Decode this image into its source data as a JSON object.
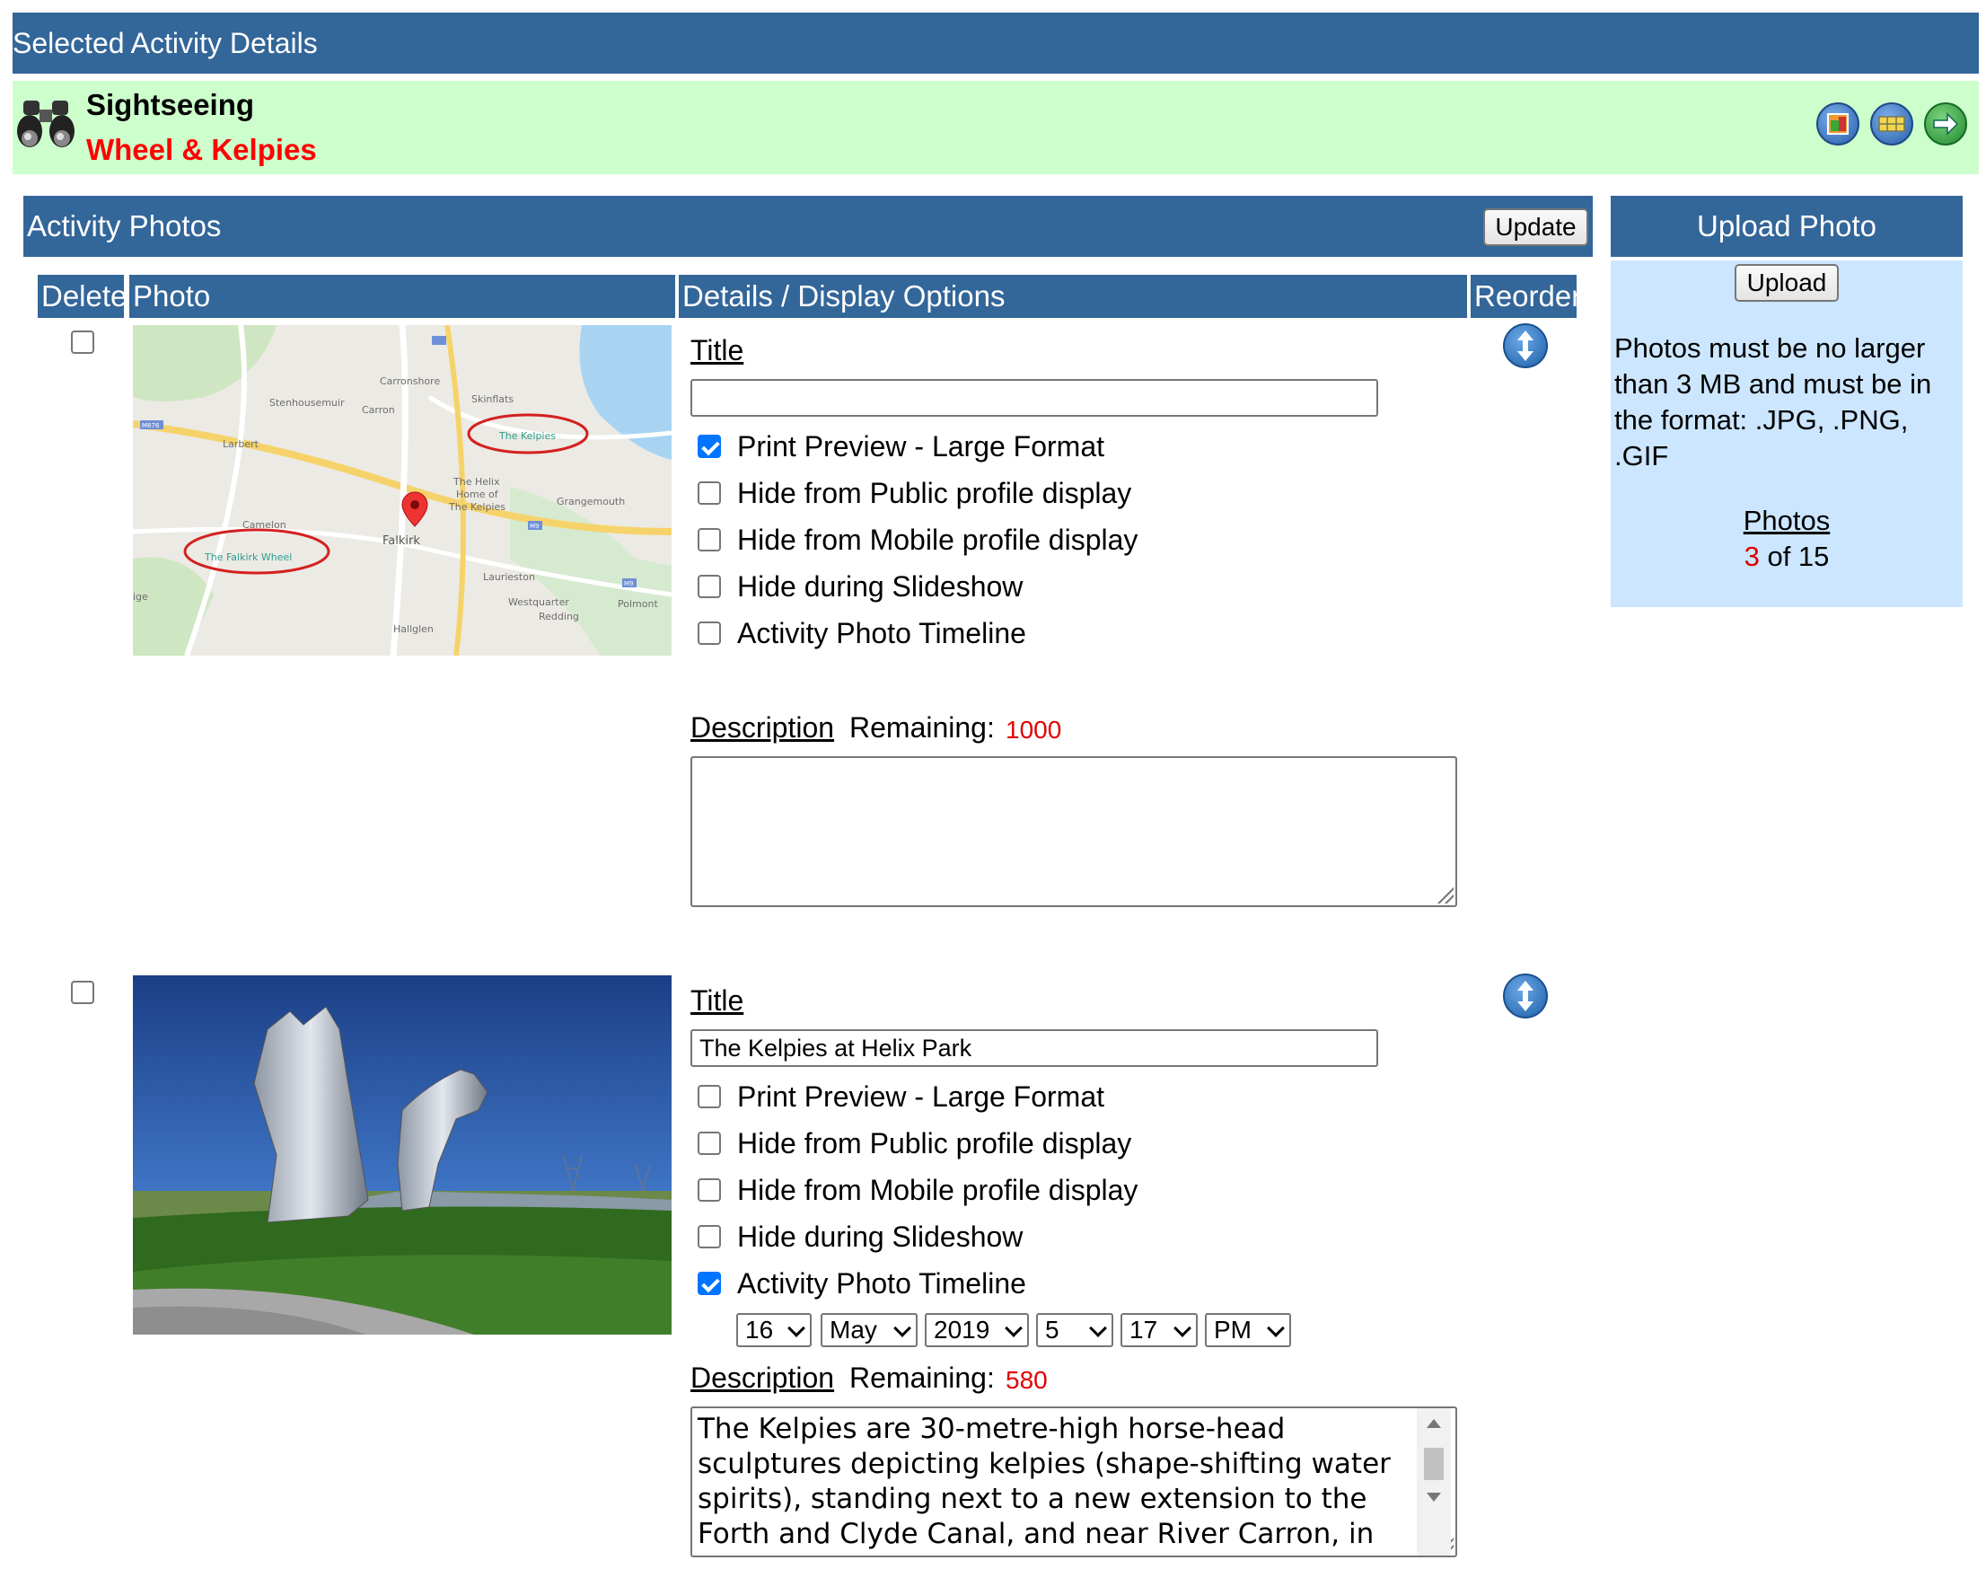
{
  "header": {
    "title": "Selected Activity Details"
  },
  "activity": {
    "type": "Sightseeing",
    "name": "Wheel & Kelpies",
    "icons": [
      "binoculars-icon",
      "gallery-icon",
      "calendar-icon",
      "next-arrow-icon"
    ]
  },
  "photos_panel": {
    "title": "Activity Photos",
    "update_label": "Update",
    "columns": {
      "delete": "Delete",
      "photo": "Photo",
      "details": "Details / Display Options",
      "reorder": "Reorder"
    }
  },
  "upload_panel": {
    "title": "Upload Photo",
    "upload_label": "Upload",
    "note": "Photos must be no larger than 3 MB and must be in the format: .JPG, .PNG, .GIF",
    "photos_link": "Photos",
    "count_current": "3",
    "count_suffix": " of 15"
  },
  "rows": [
    {
      "title_label": "Title",
      "title_value": "",
      "options": [
        {
          "label": "Print Preview - Large Format",
          "checked": true
        },
        {
          "label": "Hide from Public profile display",
          "checked": false
        },
        {
          "label": "Hide from Mobile profile display",
          "checked": false
        },
        {
          "label": "Hide during Slideshow",
          "checked": false
        },
        {
          "label": "Activity Photo Timeline",
          "checked": false
        }
      ],
      "description_label": "Description",
      "remaining_label": "Remaining:",
      "remaining_value": "1000",
      "description": "",
      "map_labels": {
        "carronshore": "Carronshore",
        "stenhousemuir": "Stenhousemuir",
        "carron": "Carron",
        "skinflats": "Skinflats",
        "kelpies": "The Kelpies",
        "larbert": "Larbert",
        "helix_1": "The Helix",
        "helix_2": "Home of",
        "helix_3": "The Kelpies",
        "grangemouth": "Grangemouth",
        "camelon": "Camelon",
        "falkirk_wheel": "The Falkirk Wheel",
        "falkirk": "Falkirk",
        "laurieston": "Laurieston",
        "westquarter": "Westquarter",
        "redding": "Redding",
        "polmont": "Polmont",
        "hallglen": "Hallglen",
        "ige": "ige",
        "m876": "M876",
        "m9": "M9",
        "m9b": "M9"
      }
    },
    {
      "title_label": "Title",
      "title_value": "The Kelpies at Helix Park",
      "options": [
        {
          "label": "Print Preview - Large Format",
          "checked": false
        },
        {
          "label": "Hide from Public profile display",
          "checked": false
        },
        {
          "label": "Hide from Mobile profile display",
          "checked": false
        },
        {
          "label": "Hide during Slideshow",
          "checked": false
        },
        {
          "label": "Activity Photo Timeline",
          "checked": true
        }
      ],
      "timeline": {
        "day": "16",
        "month": "May",
        "year": "2019",
        "hour": "5",
        "minute": "17",
        "ampm": "PM"
      },
      "description_label": "Description",
      "remaining_label": "Remaining:",
      "remaining_value": "580",
      "description": "The Kelpies are 30-metre-high horse-head sculptures depicting kelpies (shape-shifting water spirits), standing next to a new extension to the Forth and Clyde Canal, and near River Carron, in The Helix."
    }
  ]
}
